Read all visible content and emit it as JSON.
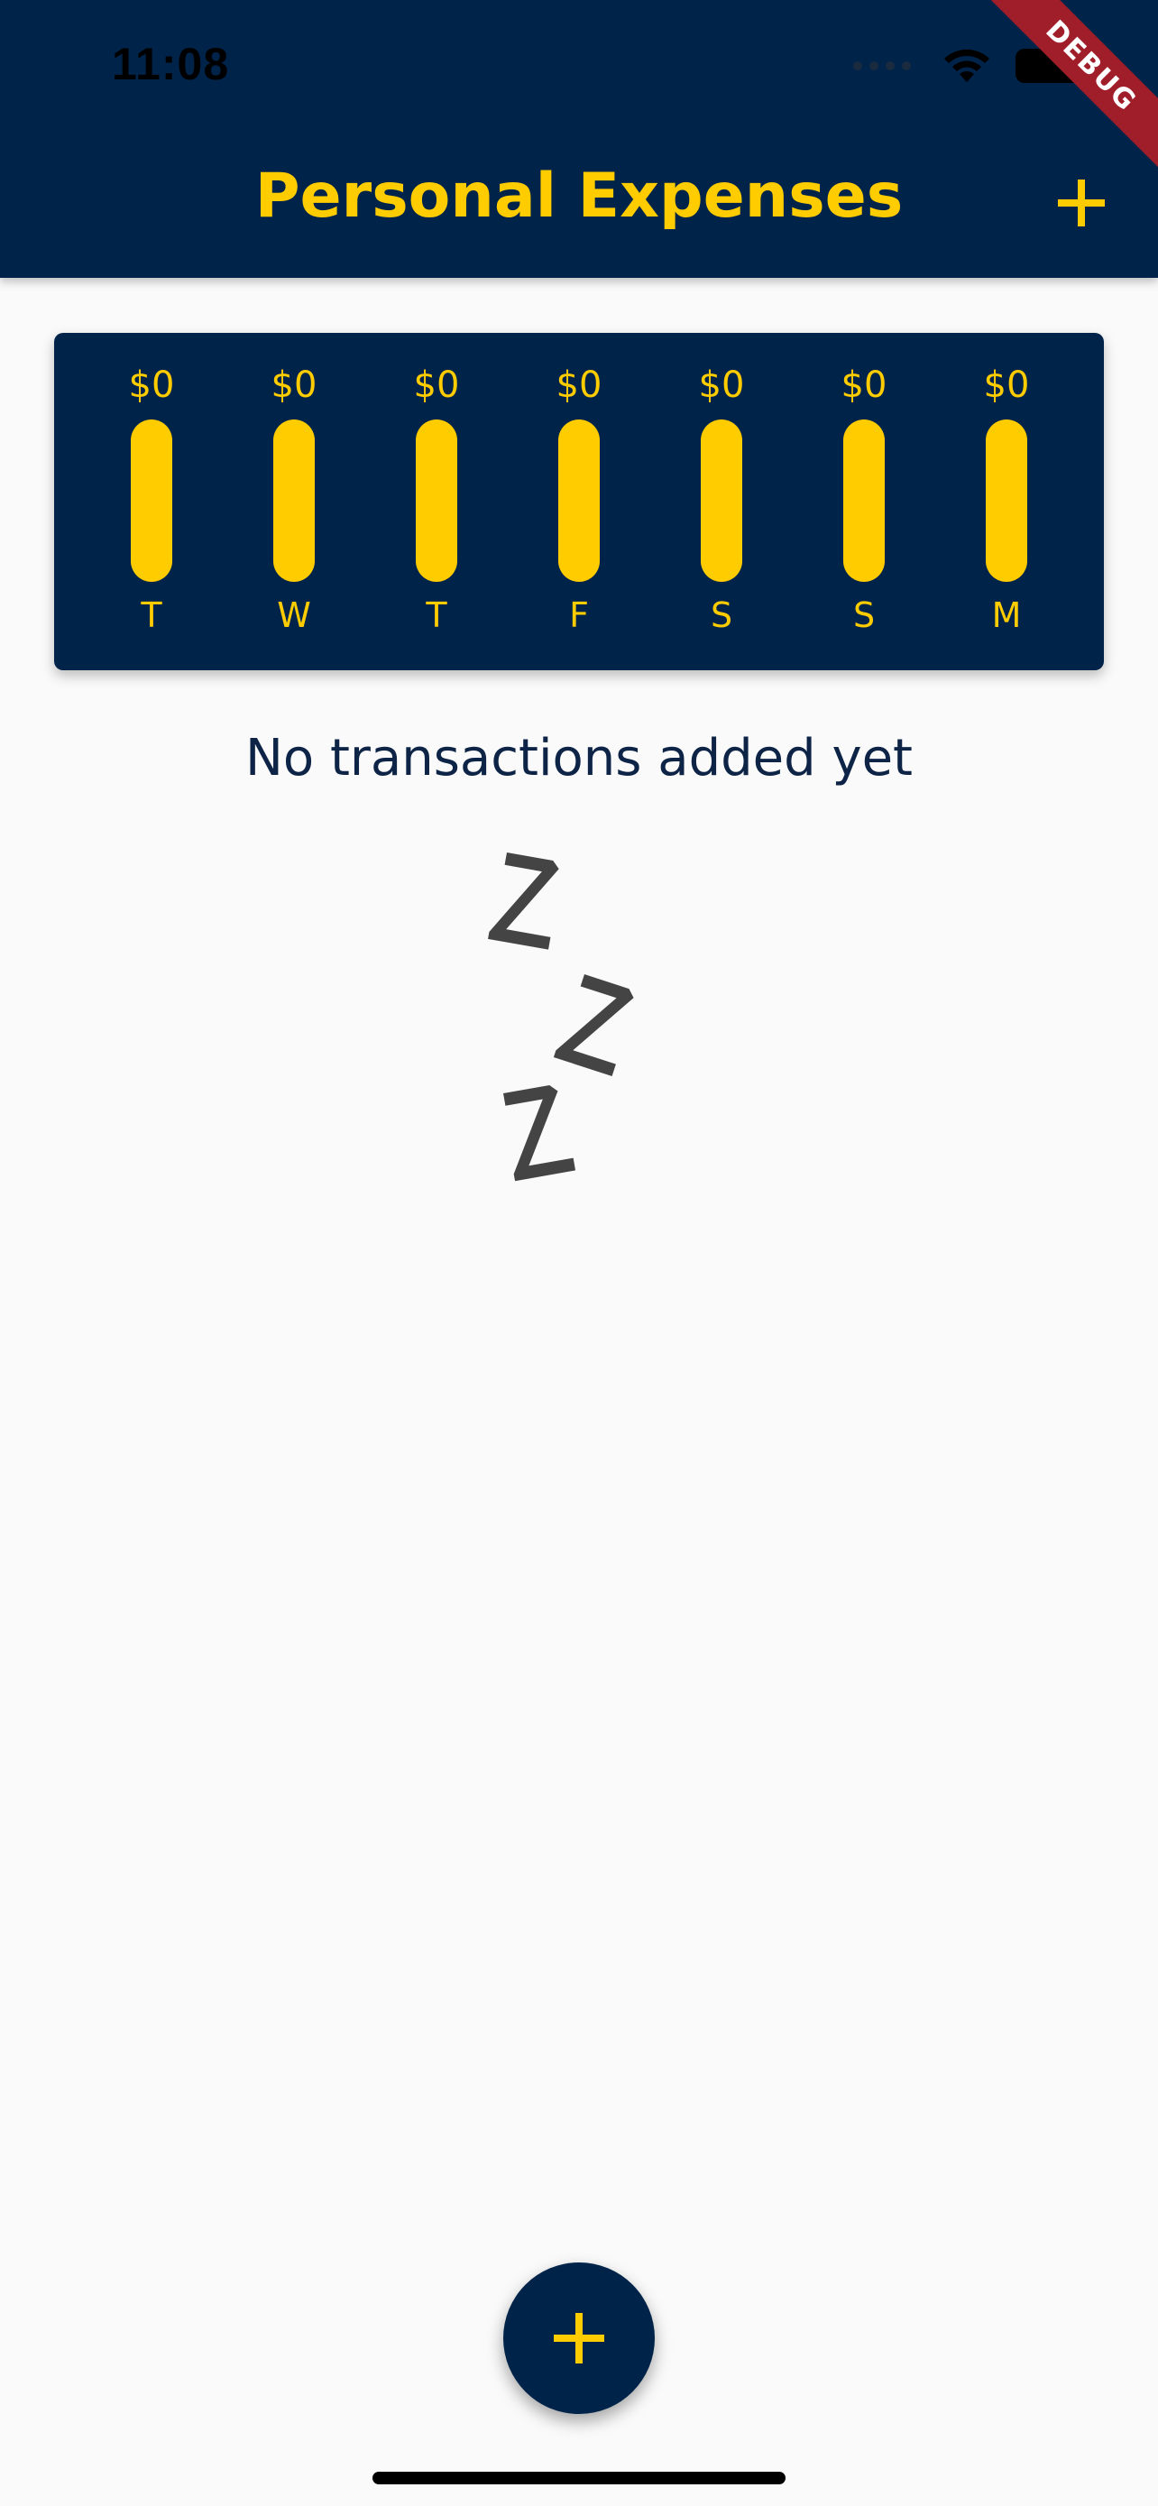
{
  "status_bar": {
    "time": "11:08"
  },
  "debug_banner": "DEBUG",
  "app_bar": {
    "title": "Personal Expenses",
    "add_icon": "plus-icon"
  },
  "chart": {
    "bars": [
      {
        "day": "T",
        "amount": "$0",
        "spending_fraction": 0
      },
      {
        "day": "W",
        "amount": "$0",
        "spending_fraction": 0
      },
      {
        "day": "T",
        "amount": "$0",
        "spending_fraction": 0
      },
      {
        "day": "F",
        "amount": "$0",
        "spending_fraction": 0
      },
      {
        "day": "S",
        "amount": "$0",
        "spending_fraction": 0
      },
      {
        "day": "S",
        "amount": "$0",
        "spending_fraction": 0
      },
      {
        "day": "M",
        "amount": "$0",
        "spending_fraction": 0
      }
    ]
  },
  "empty_state": {
    "message": "No transactions added yet",
    "image": "sleeping-zzz-image"
  },
  "fab": {
    "icon": "plus-icon"
  },
  "colors": {
    "primary": "#002349",
    "accent": "#ffcc00",
    "background": "#fafafa"
  }
}
